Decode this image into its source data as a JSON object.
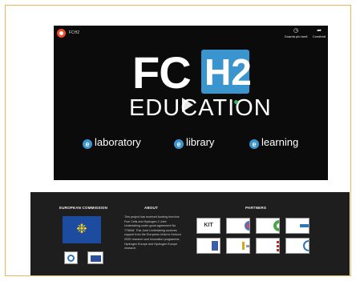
{
  "video": {
    "channel_name": "FCH2",
    "actions": [
      {
        "icon": "clock-icon",
        "label": "Guarda più tardi"
      },
      {
        "icon": "share-icon",
        "label": "Condividi"
      }
    ],
    "logo": {
      "fc": "FC",
      "h2": "H2",
      "subtitle": "EDUCATION"
    },
    "e_items": [
      {
        "prefix": "e",
        "label": "laboratory"
      },
      {
        "prefix": "e",
        "label": "library"
      },
      {
        "prefix": "e",
        "label": "learning"
      }
    ]
  },
  "footer": {
    "european_commission": "EUROPEAN COMMISSION",
    "about_heading": "ABOUT",
    "about_text": "This project has received funding from the Fuel Cells and Hydrogen 2 Joint Undertaking under grant agreement No 779848. This Joint Undertaking receives support from the European Union's Horizon 2020 research and innovation programme, Hydrogen Europe and Hydrogen Europe research.",
    "partners_heading": "PARTNERS",
    "partners": [
      "KIT",
      "",
      "",
      "",
      "",
      "",
      "",
      ""
    ]
  },
  "colors": {
    "accent_blue": "#3a95cf",
    "frame_border": "#e8b75a",
    "footer_bg": "#1e1e1e",
    "eu_blue": "#1d4ba0",
    "eu_gold": "#f4d11c"
  }
}
